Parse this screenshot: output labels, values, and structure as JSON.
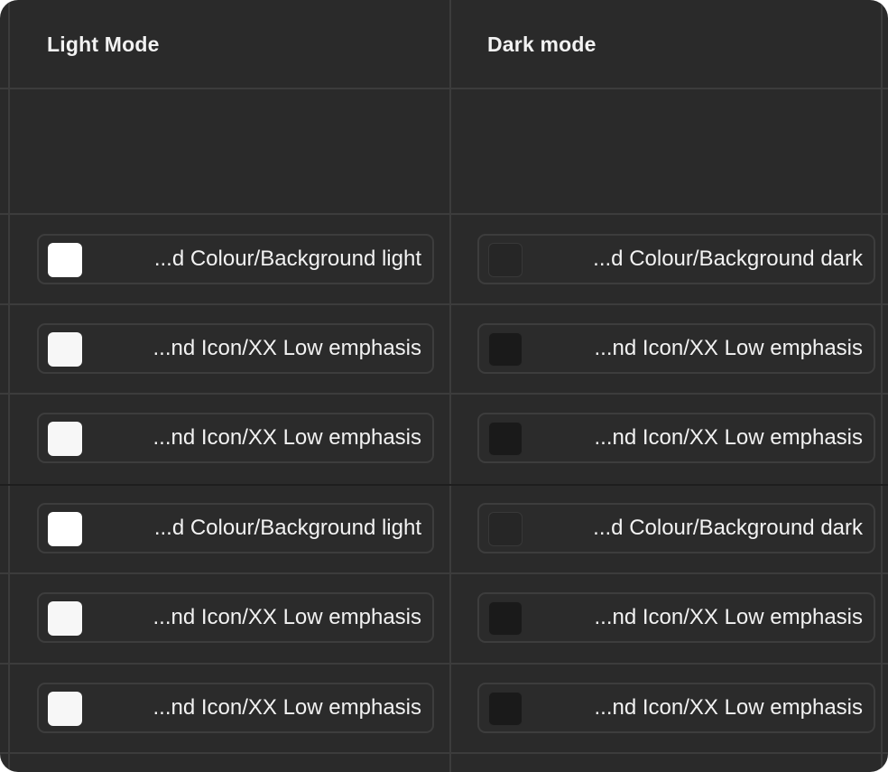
{
  "table": {
    "headers": {
      "light": "Light Mode",
      "dark": "Dark mode"
    },
    "rows": [
      {
        "light": {
          "label": "...d Colour/Background light",
          "swatch_color": "#ffffff"
        },
        "dark": {
          "label": "...d Colour/Background dark",
          "swatch_color": "#262626"
        }
      },
      {
        "light": {
          "label": "...nd Icon/XX Low emphasis",
          "swatch_color": "#f7f7f7"
        },
        "dark": {
          "label": "...nd Icon/XX Low emphasis",
          "swatch_color": "#1a1a1a"
        }
      },
      {
        "light": {
          "label": "...nd Icon/XX Low emphasis",
          "swatch_color": "#f7f7f7"
        },
        "dark": {
          "label": "...nd Icon/XX Low emphasis",
          "swatch_color": "#1a1a1a"
        }
      },
      {
        "light": {
          "label": "...d Colour/Background light",
          "swatch_color": "#ffffff"
        },
        "dark": {
          "label": "...d Colour/Background dark",
          "swatch_color": "#262626"
        }
      },
      {
        "light": {
          "label": "...nd Icon/XX Low emphasis",
          "swatch_color": "#f7f7f7"
        },
        "dark": {
          "label": "...nd Icon/XX Low emphasis",
          "swatch_color": "#1a1a1a"
        }
      },
      {
        "light": {
          "label": "...nd Icon/XX Low emphasis",
          "swatch_color": "#f7f7f7"
        },
        "dark": {
          "label": "...nd Icon/XX Low emphasis",
          "swatch_color": "#1a1a1a"
        }
      }
    ]
  },
  "colors": {
    "panel_bg": "#2a2a2a",
    "grid_line": "#3c3c3c",
    "text": "#f2f2f2"
  }
}
